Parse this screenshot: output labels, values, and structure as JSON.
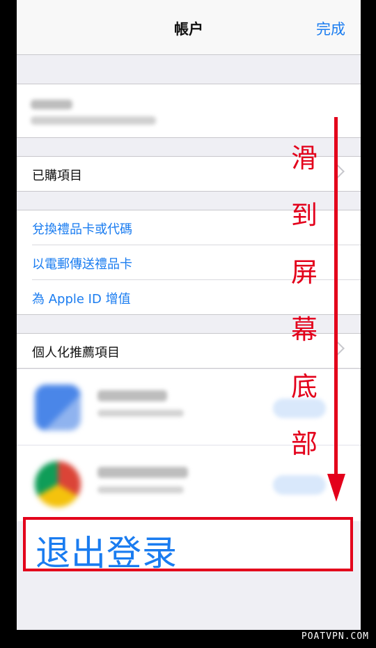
{
  "navbar": {
    "title": "帳户",
    "done_label": "完成"
  },
  "menu": {
    "purchased": "已購項目",
    "redeem": "兌換禮品卡或代碼",
    "send_gift": "以電郵傳送禮品卡",
    "add_funds": "為 Apple ID 增值",
    "personalized": "個人化推薦項目"
  },
  "logout_label": "退出登录",
  "annotation": {
    "chars": [
      "滑",
      "到",
      "屏",
      "幕",
      "底",
      "部"
    ]
  },
  "watermark": "POATVPN.COM",
  "colors": {
    "link": "#1a7cf0",
    "annotation_red": "#e3001b"
  }
}
